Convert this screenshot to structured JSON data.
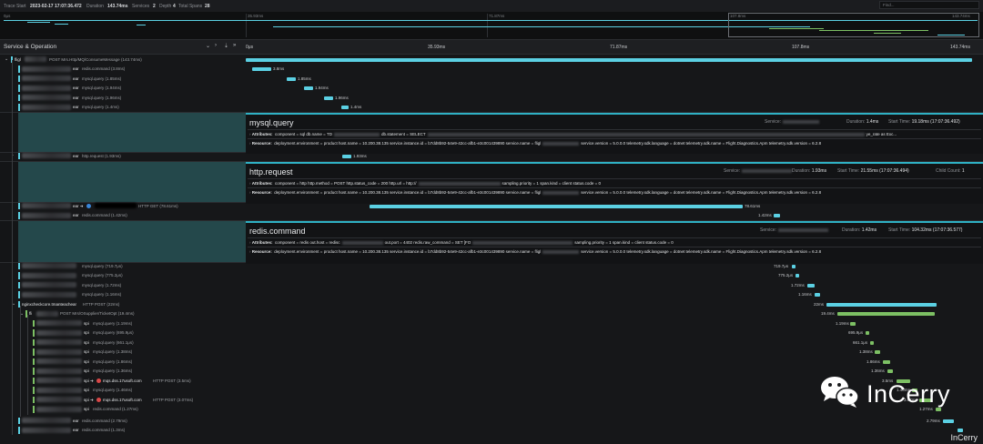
{
  "header": {
    "trace_start_label": "Trace Start",
    "trace_start": "2023-02-17 17:07:36.472",
    "duration_label": "Duration",
    "duration": "143.74ms",
    "services_label": "Services",
    "services": "2",
    "depth_label": "Depth",
    "depth": "4",
    "total_spans_label": "Total Spans",
    "total_spans": "28",
    "find_placeholder": "Find..."
  },
  "minimap": {
    "ticks": [
      "0μs",
      "35.93ms",
      "71.87ms",
      "107.8ms",
      "143.74ms"
    ]
  },
  "columns": {
    "service_operation": "Service & Operation",
    "ticks": [
      "0μs",
      "35.93ms",
      "71.87ms",
      "107.8ms",
      "143.74ms"
    ]
  },
  "colors": {
    "accent": "#5bd0e3",
    "green": "#7dc064",
    "detail_left": "#24484b"
  },
  "rows": [
    {
      "id": "r0",
      "svc": "fligl",
      "label": "POST Mrs.Http/MQ/ConsumeMessage (143.74ms)",
      "dur": ""
    },
    {
      "id": "r1",
      "svc": "ear",
      "label": "redis.command (3.8ms)",
      "dur": "3.8ms"
    },
    {
      "id": "r2",
      "svc": "ear",
      "label": "mysql.query (1.85ms)",
      "dur": "1.85ms"
    },
    {
      "id": "r3",
      "svc": "ear",
      "label": "mysql.query (1.94ms)",
      "dur": "1.94ms"
    },
    {
      "id": "r4",
      "svc": "ear",
      "label": "mysql.query (1.96ms)",
      "dur": "1.96ms"
    },
    {
      "id": "r5",
      "svc": "ear",
      "label": "mysql.query (1.4ms)",
      "dur": "1.4ms"
    },
    {
      "id": "r6",
      "svc": "ear",
      "label": "http.request (1.93ms)",
      "dur": "1.93ms"
    },
    {
      "id": "r7",
      "svc": "ear",
      "label": "HTTP GET (78.61ms)",
      "dur": "78.61ms"
    },
    {
      "id": "r8",
      "svc": "ear",
      "label": "redis.command (1.42ms)",
      "dur": "1.42ms"
    },
    {
      "id": "r9",
      "svc": "",
      "label": "mysql.query (719.7μs)",
      "dur": "719.7μs"
    },
    {
      "id": "r10",
      "svc": "",
      "label": "mysql.query (775.2μs)",
      "dur": "775.2μs"
    },
    {
      "id": "r11",
      "svc": "",
      "label": "mysql.query (1.72ms)",
      "dur": "1.72ms"
    },
    {
      "id": "r12",
      "svc": "",
      "label": "mysql.query (1.16ms)",
      "dur": "1.16ms"
    },
    {
      "id": "r13",
      "svc": "nginxcheckcore.tmanteachear",
      "label": "HTTP POST (22ms)",
      "dur": "22ms"
    },
    {
      "id": "r14",
      "svc": "fli",
      "label": "POST Mrs/OSupplier/TicketOpt (19.4ms)",
      "dur": "19.4ms"
    },
    {
      "id": "r15",
      "svc": "spi",
      "label": "mysql.query (1.19ms)",
      "dur": "1.19ms"
    },
    {
      "id": "r16",
      "svc": "spi",
      "label": "mysql.query (695.9μs)",
      "dur": "695.9μs"
    },
    {
      "id": "r17",
      "svc": "spi",
      "label": "mysql.query (661.1μs)",
      "dur": "661.1μs"
    },
    {
      "id": "r18",
      "svc": "spi",
      "label": "mysql.query (1.38ms)",
      "dur": "1.38ms"
    },
    {
      "id": "r19",
      "svc": "spi",
      "label": "mysql.query (1.86ms)",
      "dur": "1.86ms"
    },
    {
      "id": "r20",
      "svc": "spi",
      "label": "mysql.query (1.36ms)",
      "dur": "1.36ms"
    },
    {
      "id": "r21",
      "svc": "spi",
      "ext": "mqs.dss.17usoft.com",
      "label": "HTTP POST (3.5ms)",
      "dur": "3.5ms"
    },
    {
      "id": "r22",
      "svc": "spi",
      "label": "mysql.query (1.46ms)",
      "dur": "1.46ms"
    },
    {
      "id": "r23",
      "svc": "spi",
      "ext": "mqs.dss.17usoft.com",
      "label": "HTTP POST (3.07ms)",
      "dur": "3.07ms"
    },
    {
      "id": "r24",
      "svc": "spi",
      "label": "redis.command (1.27ms)",
      "dur": "1.27ms"
    },
    {
      "id": "r25",
      "svc": "ear",
      "label": "redis.command (2.79ms)",
      "dur": "2.79ms"
    },
    {
      "id": "r26",
      "svc": "ear",
      "label": "redis.command (1.3ms)",
      "dur": "1.3ms"
    }
  ],
  "details": {
    "mysql": {
      "title": "mysql.query",
      "service_label": "Service:",
      "duration_label": "Duration:",
      "duration": "1.4ms",
      "start_label": "Start Time:",
      "start": "19.18ms (17:07:36.492)",
      "attributes_label": "Attributes:",
      "attrs": "component = sql   db.name = TD",
      "attrs2": "db.statement = SELECT",
      "attrs3": "ye_rate as Exc...",
      "resource_label": "Resource:",
      "res": "deployment.environment = product   host.name = 10.200.38.135   service.instance.id = b7dd8b92-54e9-42cc-afb1-e3c001439890   service.name = fligl",
      "res2": "service.version = 5.0.0.0   telemetry.sdk.language = dotnet   telemetry.sdk.name = Flight.Diagnostics.Apm   telemetry.sdk.version = 6.2.8"
    },
    "http": {
      "title": "http.request",
      "service_label": "Service:",
      "duration_label": "Duration:",
      "duration": "1.93ms",
      "start_label": "Start Time:",
      "start": "21.55ms (17:07:36.494)",
      "child_label": "Child Count:",
      "child": "1",
      "attributes_label": "Attributes:",
      "attrs": "component = http   http.method = POST   http.status_code = 200   http.url = http://",
      "attrs2": "sampling.priority = 1   span.kind = client   status.code = 0",
      "resource_label": "Resource:",
      "res": "deployment.environment = product   host.name = 10.200.38.135   service.instance.id = b7dd8b92-54e9-42cc-afb1-e3c001439890   service.name = fligl",
      "res2": "service.version = 5.0.0.0   telemetry.sdk.language = dotnet   telemetry.sdk.name = Flight.Diagnostics.Apm   telemetry.sdk.version = 6.2.8"
    },
    "redis": {
      "title": "redis.command",
      "service_label": "Service:",
      "duration_label": "Duration:",
      "duration": "1.42ms",
      "start_label": "Start Time:",
      "start": "104.32ms (17:07:36.577)",
      "attributes_label": "Attributes:",
      "attrs": "component = redis   out.host = redisc",
      "attrs2": "out.port = 4402   redis.raw_command = SET [FO",
      "attrs3": "sampling.priority = 1   span.kind = client   status.code = 0",
      "resource_label": "Resource:",
      "res": "deployment.environment = product   host.name = 10.200.38.135   service.instance.id = b7dd8b92-54e9-42cc-afb1-e3c001439890   service.name = fligl",
      "res2": "service.version = 5.0.0.0   telemetry.sdk.language = dotnet   telemetry.sdk.name = Flight.Diagnostics.Apm   telemetry.sdk.version = 6.2.8"
    }
  },
  "watermark": {
    "text": "InCerry",
    "corner": "InCerry"
  }
}
